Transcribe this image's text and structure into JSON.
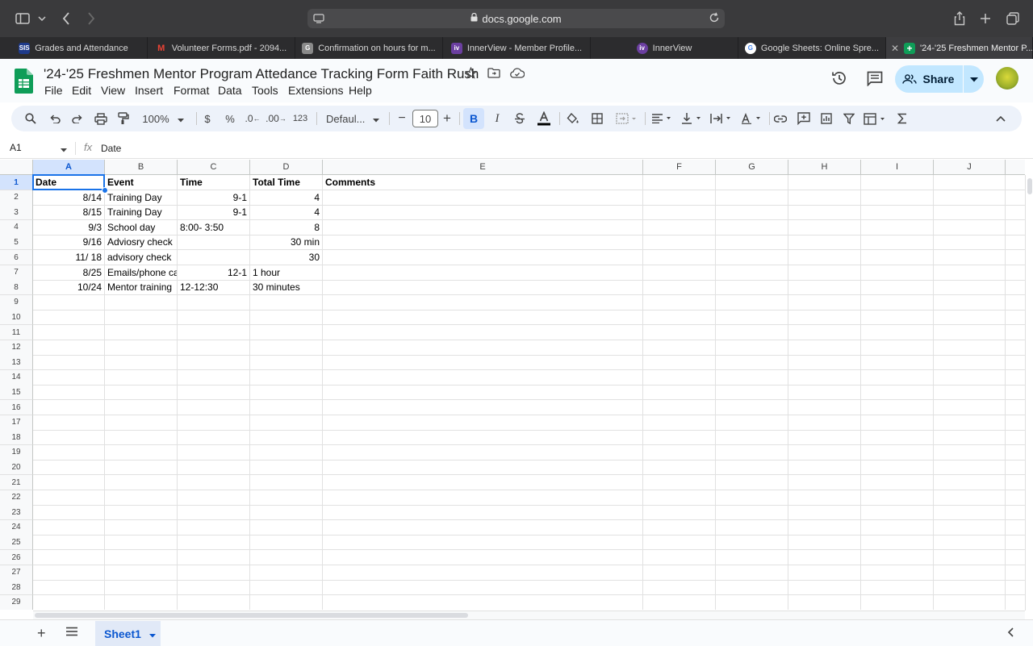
{
  "browser": {
    "url": "docs.google.com"
  },
  "tabs": [
    {
      "label": "Grades and Attendance",
      "favicon": "SIS",
      "color": "#1e3a8a"
    },
    {
      "label": "Volunteer Forms.pdf - 2094...",
      "favicon": "M",
      "color": "#ea4335"
    },
    {
      "label": "Confirmation on hours for m...",
      "favicon": "G",
      "color": "#8a8a8a"
    },
    {
      "label": "InnerView - Member Profile...",
      "favicon": "iv",
      "color": "#6b3fa0"
    },
    {
      "label": "InnerView",
      "favicon": "iv",
      "color": "#6b3fa0"
    },
    {
      "label": "Google Sheets: Online Spre...",
      "favicon": "G",
      "color": "#4285f4"
    },
    {
      "label": "'24-'25 Freshmen Mentor P...",
      "favicon": "+",
      "color": "#0f9d58"
    }
  ],
  "doc": {
    "title": "'24-'25 Freshmen Mentor Program Attedance Tracking Form Faith Rush"
  },
  "menu": [
    "File",
    "Edit",
    "View",
    "Insert",
    "Format",
    "Data",
    "Tools",
    "Extensions",
    "Help"
  ],
  "header": {
    "share_label": "Share"
  },
  "toolbar": {
    "zoom": "100%",
    "currency": "$",
    "percent": "%",
    "dec_decrease": ".0",
    "dec_increase": ".00",
    "more_formats": "123",
    "font": "Defaul...",
    "font_size": "10",
    "minus": "−",
    "plus": "+",
    "bold": "B",
    "italic": "I"
  },
  "formula_bar": {
    "cell_ref": "A1",
    "fx": "fx",
    "content": "Date"
  },
  "columns": [
    "A",
    "B",
    "C",
    "D",
    "E",
    "F",
    "G",
    "H",
    "I",
    "J"
  ],
  "rows": [
    "1",
    "2",
    "3",
    "4",
    "5",
    "6",
    "7",
    "8",
    "9",
    "10",
    "11",
    "12",
    "13",
    "14",
    "15",
    "16",
    "17",
    "18",
    "19",
    "20",
    "21",
    "22",
    "23",
    "24",
    "25",
    "26",
    "27",
    "28",
    "29"
  ],
  "sheet": {
    "header": [
      "Date",
      "Event",
      "Time",
      "Total Time",
      "Comments"
    ],
    "data": [
      [
        "8/14",
        "Training Day",
        "9-1",
        "4",
        ""
      ],
      [
        "8/15",
        "Training Day",
        "9-1",
        "4",
        ""
      ],
      [
        "9/3",
        "School day",
        "8:00- 3:50",
        "8",
        ""
      ],
      [
        "9/16",
        "Adviosry check",
        "",
        "30 min",
        ""
      ],
      [
        "11/ 18",
        "advisory check",
        "",
        "30",
        ""
      ],
      [
        "8/25",
        "Emails/phone ca",
        "12-1",
        "1 hour",
        ""
      ],
      [
        "10/24",
        "Mentor training",
        "12-12:30",
        "30 minutes",
        ""
      ]
    ]
  },
  "bottom": {
    "sheet_tab": "Sheet1"
  }
}
